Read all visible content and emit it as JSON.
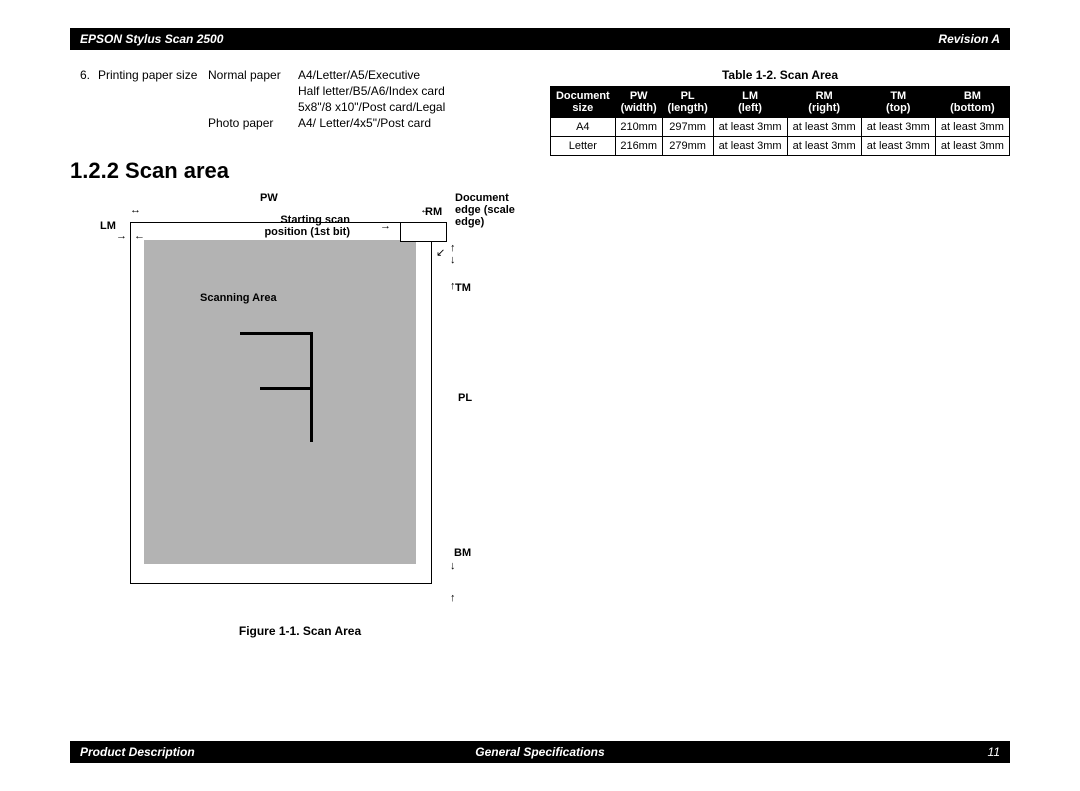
{
  "header": {
    "left": "EPSON Stylus Scan 2500",
    "right": "Revision A"
  },
  "footer": {
    "left": "Product Description",
    "center": "General Specifications",
    "right": "11"
  },
  "paperSpec": {
    "num": "6.",
    "label": "Printing paper size",
    "normal": {
      "name": "Normal paper",
      "line1": "A4/Letter/A5/Executive",
      "line2": "Half letter/B5/A6/Index card",
      "line3": "5x8\"/8 x10\"/Post card/Legal"
    },
    "photo": {
      "name": "Photo paper",
      "line1": "A4/ Letter/4x5\"/Post card"
    }
  },
  "section": "1.2.2  Scan area",
  "diagram": {
    "pw": "PW",
    "lm": "LM",
    "start": "Starting scan position (1st bit)",
    "rm": "RM",
    "docedge": "Document edge (scale edge)",
    "scanArea": "Scanning Area",
    "tm": "TM",
    "pl": "PL",
    "bm": "BM",
    "caption": "Figure 1-1.  Scan Area"
  },
  "table": {
    "caption": "Table 1-2.  Scan Area",
    "headers": [
      {
        "l1": "Document",
        "l2": "size"
      },
      {
        "l1": "PW",
        "l2": "(width)"
      },
      {
        "l1": "PL",
        "l2": "(length)"
      },
      {
        "l1": "LM",
        "l2": "(left)"
      },
      {
        "l1": "RM",
        "l2": "(right)"
      },
      {
        "l1": "TM",
        "l2": "(top)"
      },
      {
        "l1": "BM",
        "l2": "(bottom)"
      }
    ],
    "rows": [
      {
        "size": "A4",
        "pw": "210mm",
        "pl": "297mm",
        "lm": "at least 3mm",
        "rm": "at least 3mm",
        "tm": "at least 3mm",
        "bm": "at least 3mm"
      },
      {
        "size": "Letter",
        "pw": "216mm",
        "pl": "279mm",
        "lm": "at least 3mm",
        "rm": "at least 3mm",
        "tm": "at least 3mm",
        "bm": "at least 3mm"
      }
    ]
  }
}
